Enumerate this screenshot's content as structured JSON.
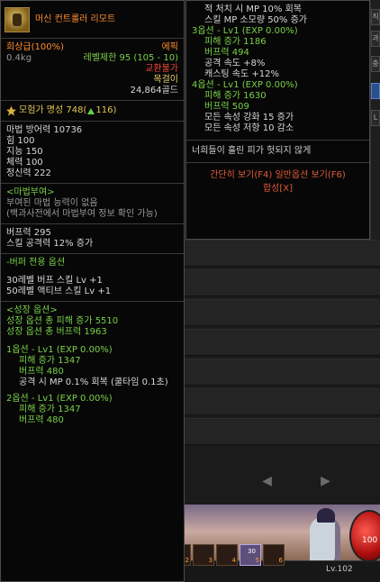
{
  "item": {
    "name": "머신 컨트롤러 리모트",
    "rarity": "희상급(100%)",
    "type": "에픽",
    "weight": "0.4kg",
    "level_req": "레벨제한 95 (105 - 10)",
    "trade": "교환불가",
    "slot": "목걸이",
    "price": "24,864골드"
  },
  "fame": {
    "label": "모험가 명성 748(",
    "delta": "116",
    "close": ")"
  },
  "stats": [
    "마법 방어력 10736",
    "힘 100",
    "지능 150",
    "체력 100",
    "정신력 222"
  ],
  "enchant": {
    "title": "<마법부여>",
    "lines": [
      "부여된 마법 능력이 없음",
      "(백과사전에서 마법부여 정보 확인 가능)"
    ]
  },
  "buff": [
    "버프력 295",
    "스킬 공격력 12% 증가"
  ],
  "buffer_option": {
    "title": "-버퍼 전용 옵션",
    "lines": [
      "30레벨 버프 스킬 Lv +1",
      "50레벨 액티브 스킬 Lv +1"
    ]
  },
  "growth": {
    "title": "<성장 옵션>",
    "summary": [
      "성장 옵션 총 피해 증가 5510",
      "성장 옵션 총 버프력 1963"
    ],
    "opt1_title": "1옵션 - Lv1 (EXP 0.00%)",
    "opt1_lines": [
      "피해 증가 1347",
      "버프력 480",
      "공격 시 MP 0.1% 회복 (쿨타임 0.1초)"
    ],
    "opt2_title": "2옵션 - Lv1 (EXP 0.00%)",
    "opt2_lines": [
      "피해 증가 1347",
      "버프력 480"
    ]
  },
  "tooltip2": {
    "top_lines": [
      "적 처치 시 MP 10% 회복",
      "스킬 MP 소모량 50% 증가"
    ],
    "opt3_title": "3옵션 - Lv1 (EXP 0.00%)",
    "opt3_lines": [
      "피해 증가 1186",
      "버프력 494",
      "공격 속도 +8%",
      "캐스팅 속도 +12%"
    ],
    "opt4_title": "4옵션 - Lv1 (EXP 0.00%)",
    "opt4_lines": [
      "피해 증가 1630",
      "버프력 509",
      "모든 속성 강화 15 증가",
      "모든 속성 저항 10 감소"
    ],
    "quote": "너희들이 흘린 피가 헛되지 않게",
    "view_buttons": "간단히 보기(F4) 일반옵션 보기(F6)",
    "combine": "합성[X]"
  },
  "hud": {
    "hp": "100",
    "level": "Lv.102",
    "slot_numbers": [
      "1",
      "2",
      "3",
      "4",
      "5",
      "6"
    ],
    "active_slot_count": "30",
    "edge_tabs": [
      "직",
      "과",
      "충",
      "",
      "L"
    ],
    "pager_prev": "◀",
    "pager_next": "▶"
  },
  "colors": {
    "epic": "#ff8d2f",
    "option": "#7ad14a",
    "untradeable": "#f04a3a",
    "fame": "#e2c554"
  }
}
